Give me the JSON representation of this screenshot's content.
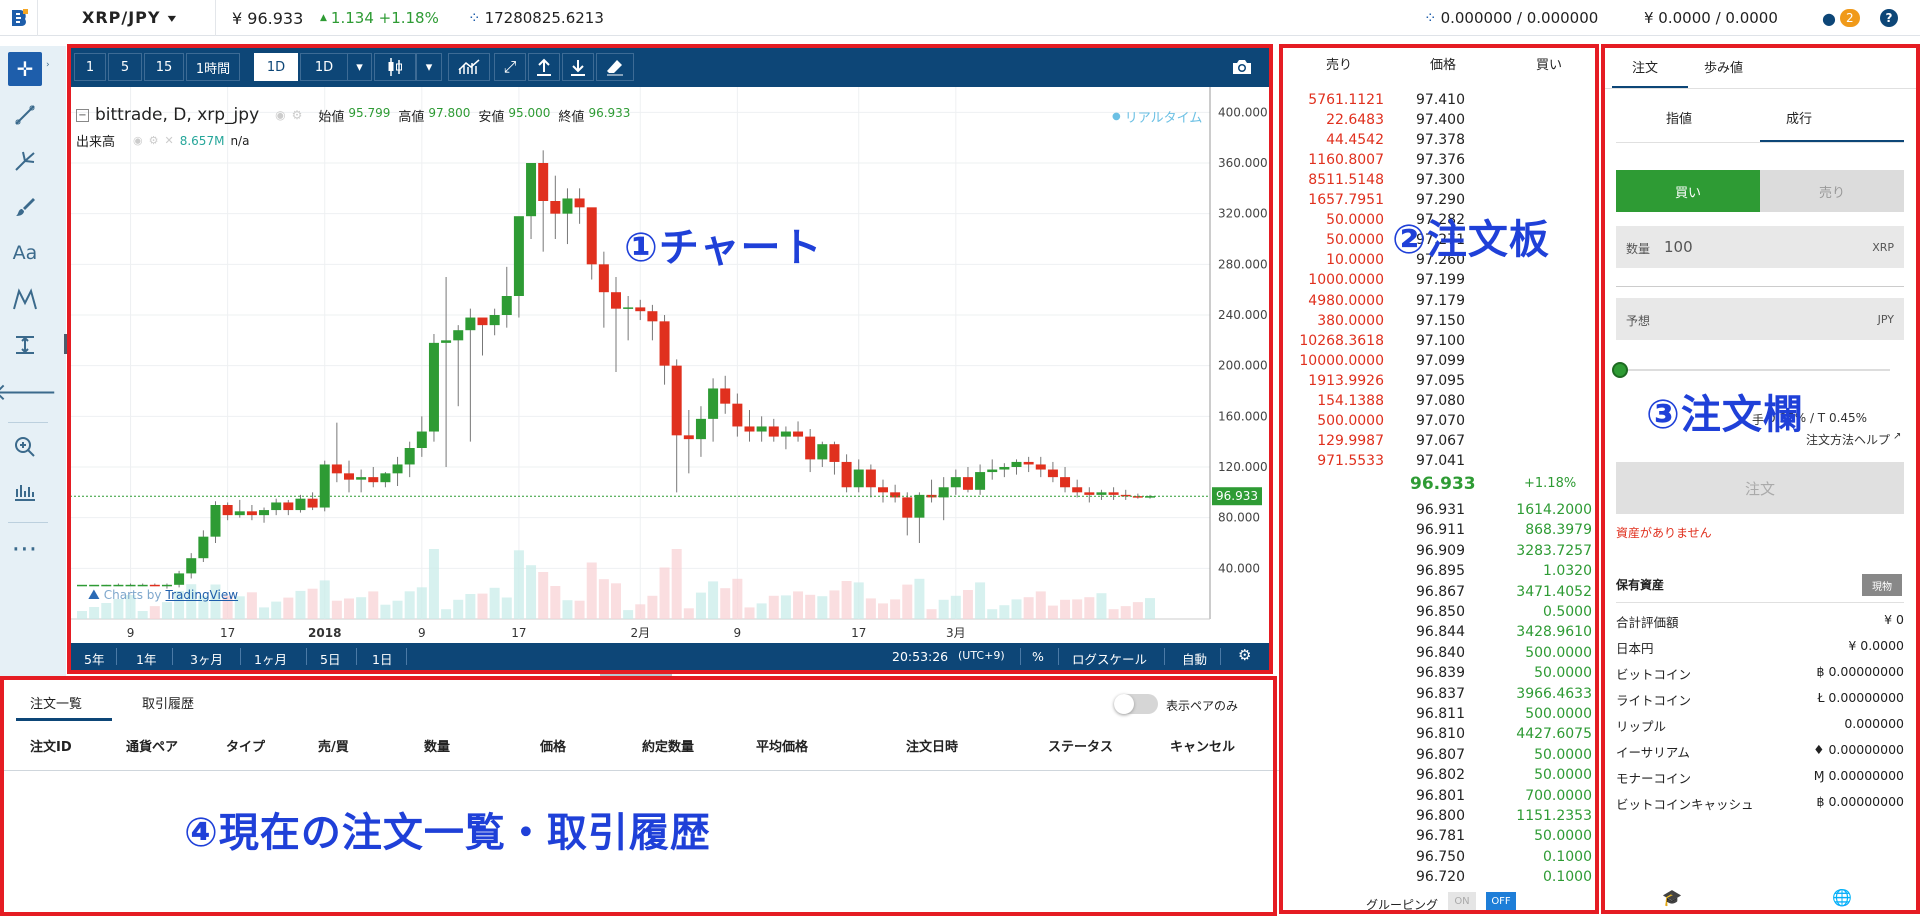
{
  "topbar": {
    "pair": "XRP/JPY",
    "price": "¥ 96.933",
    "change": "1.134 +1.18%",
    "volume": "17280825.6213",
    "xrp_balance": "0.000000 / 0.000000",
    "jpy_balance": "¥ 0.0000 / 0.0000",
    "notif_count": "2"
  },
  "chart_toolbar": {
    "intervals": [
      "1",
      "5",
      "15",
      "1時間",
      "1D",
      "1D"
    ]
  },
  "chart_header": {
    "title": "bittrade, D, xrp_jpy",
    "open_label": "始値",
    "open": "95.799",
    "high_label": "高値",
    "high": "97.800",
    "low_label": "安値",
    "low": "95.000",
    "close_label": "終値",
    "close": "96.933",
    "volume_label": "出来高",
    "volume_value": "8.657M",
    "volume_extra": "n/a",
    "realtime": "リアルタイム",
    "watermark_prefix": "Charts by",
    "watermark_brand": "TradingView"
  },
  "chart_data": {
    "type": "candlestick",
    "y_ticks": [
      "400.000",
      "360.000",
      "320.000",
      "280.000",
      "240.000",
      "200.000",
      "160.000",
      "120.000",
      "80.000",
      "40.000"
    ],
    "x_ticks": [
      "9",
      "17",
      "2018",
      "9",
      "17",
      "2月",
      "9",
      "17",
      "3月"
    ],
    "last_price": "96.933",
    "ylim": [
      0,
      420
    ],
    "candles": [
      [
        27,
        27,
        27,
        27
      ],
      [
        27,
        27,
        27,
        27
      ],
      [
        27,
        27,
        26,
        27
      ],
      [
        27,
        28,
        26,
        27
      ],
      [
        27,
        28,
        26,
        27
      ],
      [
        27,
        28,
        26,
        27
      ],
      [
        27,
        28,
        26,
        26
      ],
      [
        26,
        28,
        24,
        27
      ],
      [
        27,
        38,
        25,
        36
      ],
      [
        36,
        52,
        32,
        48
      ],
      [
        48,
        70,
        45,
        65
      ],
      [
        65,
        93,
        60,
        90
      ],
      [
        90,
        92,
        78,
        82
      ],
      [
        82,
        94,
        80,
        85
      ],
      [
        85,
        90,
        78,
        82
      ],
      [
        82,
        88,
        76,
        86
      ],
      [
        86,
        95,
        82,
        92
      ],
      [
        92,
        94,
        82,
        86
      ],
      [
        86,
        98,
        84,
        95
      ],
      [
        95,
        100,
        86,
        88
      ],
      [
        88,
        125,
        85,
        122
      ],
      [
        122,
        155,
        108,
        115
      ],
      [
        115,
        125,
        100,
        110
      ],
      [
        110,
        118,
        100,
        112
      ],
      [
        112,
        120,
        104,
        108
      ],
      [
        108,
        116,
        104,
        115
      ],
      [
        115,
        128,
        105,
        122
      ],
      [
        122,
        140,
        112,
        135
      ],
      [
        135,
        160,
        128,
        148
      ],
      [
        148,
        225,
        140,
        218
      ],
      [
        218,
        270,
        120,
        220
      ],
      [
        220,
        232,
        168,
        228
      ],
      [
        228,
        245,
        140,
        238
      ],
      [
        238,
        236,
        208,
        232
      ],
      [
        232,
        245,
        224,
        240
      ],
      [
        240,
        278,
        230,
        255
      ],
      [
        255,
        300,
        238,
        318
      ],
      [
        318,
        360,
        300,
        360
      ],
      [
        360,
        370,
        290,
        330
      ],
      [
        330,
        350,
        300,
        320
      ],
      [
        320,
        340,
        296,
        332
      ],
      [
        332,
        340,
        312,
        325
      ],
      [
        325,
        320,
        268,
        280
      ],
      [
        280,
        290,
        230,
        258
      ],
      [
        258,
        270,
        195,
        245
      ],
      [
        245,
        255,
        220,
        246
      ],
      [
        246,
        252,
        236,
        243
      ],
      [
        243,
        248,
        220,
        235
      ],
      [
        235,
        240,
        185,
        200
      ],
      [
        200,
        205,
        100,
        145
      ],
      [
        145,
        165,
        115,
        142
      ],
      [
        142,
        168,
        128,
        158
      ],
      [
        158,
        190,
        140,
        182
      ],
      [
        182,
        192,
        162,
        170
      ],
      [
        170,
        178,
        144,
        152
      ],
      [
        152,
        165,
        140,
        148
      ],
      [
        148,
        160,
        140,
        152
      ],
      [
        152,
        158,
        140,
        144
      ],
      [
        144,
        152,
        134,
        148
      ],
      [
        148,
        156,
        140,
        144
      ],
      [
        144,
        150,
        116,
        126
      ],
      [
        126,
        140,
        120,
        138
      ],
      [
        138,
        140,
        114,
        124
      ],
      [
        124,
        130,
        100,
        104
      ],
      [
        104,
        126,
        100,
        118
      ],
      [
        118,
        122,
        96,
        104
      ],
      [
        104,
        110,
        92,
        100
      ],
      [
        100,
        106,
        92,
        96
      ],
      [
        96,
        100,
        66,
        80
      ],
      [
        80,
        100,
        60,
        98
      ],
      [
        98,
        110,
        92,
        96
      ],
      [
        96,
        112,
        78,
        104
      ],
      [
        104,
        118,
        98,
        112
      ],
      [
        112,
        120,
        100,
        102
      ],
      [
        102,
        122,
        98,
        116
      ],
      [
        116,
        126,
        110,
        118
      ],
      [
        118,
        123,
        112,
        120
      ],
      [
        120,
        126,
        114,
        124
      ],
      [
        124,
        128,
        116,
        122
      ],
      [
        122,
        128,
        112,
        118
      ],
      [
        118,
        124,
        108,
        112
      ],
      [
        112,
        120,
        100,
        104
      ],
      [
        104,
        110,
        96,
        100
      ],
      [
        100,
        104,
        92,
        98
      ],
      [
        98,
        102,
        94,
        100
      ],
      [
        100,
        104,
        94,
        98
      ],
      [
        98,
        102,
        94,
        97
      ],
      [
        97,
        99,
        95,
        96
      ],
      [
        96,
        98,
        95,
        97
      ]
    ]
  },
  "chart_bottom": {
    "ranges": [
      "5年",
      "1年",
      "3ヶ月",
      "1ヶ月",
      "5日",
      "1日"
    ],
    "time": "20:53:26",
    "tz": "(UTC+9)",
    "percent": "%",
    "log": "ログスケール",
    "auto": "自動"
  },
  "orderbook": {
    "headers": [
      "売り",
      "価格",
      "買い"
    ],
    "asks": [
      [
        "5761.1121",
        "97.410"
      ],
      [
        "22.6483",
        "97.400"
      ],
      [
        "44.4542",
        "97.378"
      ],
      [
        "1160.8007",
        "97.376"
      ],
      [
        "8511.5148",
        "97.300"
      ],
      [
        "1657.7951",
        "97.290"
      ],
      [
        "50.0000",
        "97.282"
      ],
      [
        "50.0000",
        "97.271"
      ],
      [
        "10.0000",
        "97.260"
      ],
      [
        "1000.0000",
        "97.199"
      ],
      [
        "4980.0000",
        "97.179"
      ],
      [
        "380.0000",
        "97.150"
      ],
      [
        "10268.3618",
        "97.100"
      ],
      [
        "10000.0000",
        "97.099"
      ],
      [
        "1913.9926",
        "97.095"
      ],
      [
        "154.1388",
        "97.080"
      ],
      [
        "500.0000",
        "97.070"
      ],
      [
        "129.9987",
        "97.067"
      ],
      [
        "971.5533",
        "97.041"
      ]
    ],
    "mid_price": "96.933",
    "mid_change": "+1.18%",
    "bids": [
      [
        "96.931",
        "1614.2000"
      ],
      [
        "96.911",
        "868.3979"
      ],
      [
        "96.909",
        "3283.7257"
      ],
      [
        "96.895",
        "1.0320"
      ],
      [
        "96.867",
        "3471.4052"
      ],
      [
        "96.850",
        "0.5000"
      ],
      [
        "96.844",
        "3428.9610"
      ],
      [
        "96.840",
        "500.0000"
      ],
      [
        "96.839",
        "50.0000"
      ],
      [
        "96.837",
        "3966.4633"
      ],
      [
        "96.811",
        "500.0000"
      ],
      [
        "96.810",
        "4427.6075"
      ],
      [
        "96.807",
        "50.0000"
      ],
      [
        "96.802",
        "50.0000"
      ],
      [
        "96.801",
        "700.0000"
      ],
      [
        "96.800",
        "1151.2353"
      ],
      [
        "96.781",
        "50.0000"
      ],
      [
        "96.750",
        "0.1000"
      ],
      [
        "96.720",
        "0.1000"
      ]
    ],
    "grouping_label": "グルーピング",
    "grouping_on": "ON",
    "grouping_off": "OFF"
  },
  "orderform": {
    "tab_order": "注文",
    "tab_trades": "歩み値",
    "limit": "指値",
    "market": "成行",
    "buy": "買い",
    "sell": "売り",
    "qty_label": "数量",
    "qty_value": "100",
    "qty_unit": "XRP",
    "est_label": "予想",
    "est_unit": "JPY",
    "fee_label": "手",
    "fee": "0.25% / T 0.45%",
    "help": "注文方法ヘルプ",
    "submit": "注文",
    "no_assets": "資産がありません",
    "holdings_title": "保有資産",
    "spot": "現物",
    "holdings": [
      [
        "合計評価額",
        "¥ 0"
      ],
      [
        "日本円",
        "¥ 0.0000"
      ],
      [
        "ビットコイン",
        "฿ 0.00000000"
      ],
      [
        "ライトコイン",
        "Ł 0.00000000"
      ],
      [
        "リップル",
        "0.000000"
      ],
      [
        "イーサリアム",
        "♦ 0.00000000"
      ],
      [
        "モナーコイン",
        "Ɱ 0.00000000"
      ],
      [
        "ビットコインキャッシュ",
        "฿ 0.00000000"
      ]
    ]
  },
  "orders": {
    "tab_open": "注文一覧",
    "tab_history": "取引履歴",
    "toggle_label": "表示ペアのみ",
    "columns": [
      "注文ID",
      "通貨ペア",
      "タイプ",
      "売/買",
      "数量",
      "価格",
      "約定数量",
      "平均価格",
      "注文日時",
      "ステータス",
      "キャンセル"
    ]
  },
  "annotations": {
    "chart": "①チャート",
    "orderbook": "②注文板",
    "orderform": "③注文欄",
    "orders": "④現在の注文一覧・取引履歴"
  },
  "colors": {
    "accent": "#1e5eab",
    "navy": "#0d4677",
    "up": "#2e9b34",
    "down": "#e0301e",
    "annotation": "#1f40d8",
    "frame": "#e51c23"
  }
}
